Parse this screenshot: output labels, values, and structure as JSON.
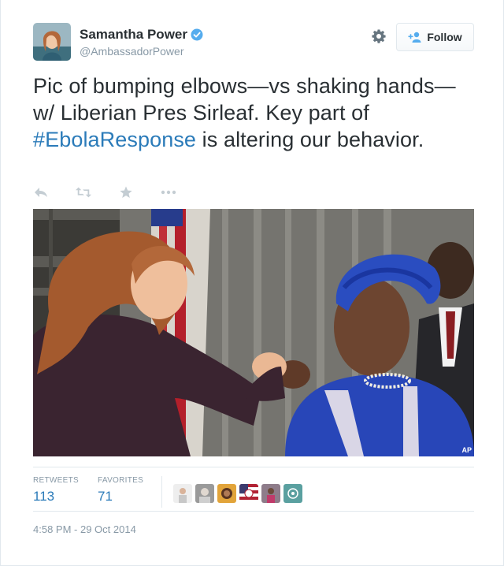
{
  "author": {
    "name": "Samantha Power",
    "handle": "@AmbassadorPower",
    "verified": true
  },
  "header": {
    "follow_label": "Follow"
  },
  "tweet": {
    "text_before": "Pic of bumping elbows—vs shaking hands—w/ Liberian Pres Sirleaf. Key part of ",
    "hashtag": "#EbolaResponse",
    "text_after": " is altering our behavior."
  },
  "actions": {
    "reply_icon": "reply-icon",
    "retweet_icon": "retweet-icon",
    "favorite_icon": "star-icon",
    "more_icon": "more-icon"
  },
  "photo": {
    "credit": "AP"
  },
  "stats": {
    "retweets_label": "RETWEETS",
    "retweets_value": "113",
    "favorites_label": "FAVORITES",
    "favorites_value": "71"
  },
  "timestamp": "4:58 PM - 29 Oct 2014",
  "colors": {
    "link": "#2b7bb9",
    "muted": "#8899a6",
    "text": "#292f33",
    "verified": "#55acee"
  }
}
